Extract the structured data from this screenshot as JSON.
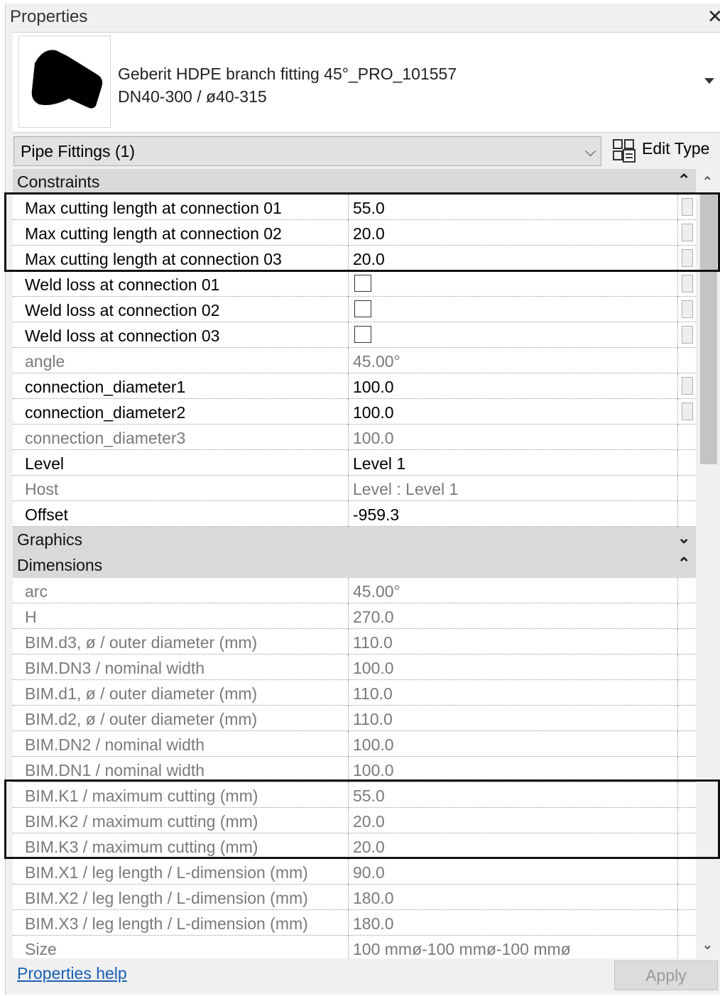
{
  "panel": {
    "title": "Properties",
    "close_glyph": "✕"
  },
  "type_selector": {
    "family_line1": "Geberit HDPE branch fitting 45°_PRO_101557",
    "family_line2": "DN40-300 / ø40-315",
    "thumbnail_icon": "pipe-branch-fitting-thumbnail"
  },
  "instance_selector": {
    "label": "Pipe Fittings (1)"
  },
  "edit_type": {
    "label": "Edit Type",
    "icon": "edit-type-icon"
  },
  "groups": {
    "constraints": {
      "label": "Constraints",
      "toggle": "⌃"
    },
    "graphics": {
      "label": "Graphics",
      "toggle": "⌄"
    },
    "dimensions": {
      "label": "Dimensions",
      "toggle": "⌃"
    }
  },
  "constraints_rows": [
    {
      "name": "Max cutting length at connection 01",
      "value": "55.0"
    },
    {
      "name": "Max cutting length at connection 02",
      "value": "20.0"
    },
    {
      "name": "Max cutting length at connection 03",
      "value": "20.0"
    },
    {
      "name": "Weld loss at connection 01",
      "value": "",
      "checkbox": false
    },
    {
      "name": "Weld loss at connection 02",
      "value": "",
      "checkbox": false
    },
    {
      "name": "Weld loss at connection 03",
      "value": "",
      "checkbox": false
    },
    {
      "name": "angle",
      "value": "45.00°"
    },
    {
      "name": "connection_diameter1",
      "value": "100.0"
    },
    {
      "name": "connection_diameter2",
      "value": "100.0"
    },
    {
      "name": "connection_diameter3",
      "value": "100.0"
    },
    {
      "name": "Level",
      "value": "Level 1"
    },
    {
      "name": "Host",
      "value": "Level : Level 1"
    },
    {
      "name": "Offset",
      "value": "-959.3"
    }
  ],
  "dimensions_rows": [
    {
      "name": "arc",
      "value": "45.00°"
    },
    {
      "name": "H",
      "value": "270.0"
    },
    {
      "name": "BIM.d3, ø / outer diameter (mm)",
      "value": "110.0"
    },
    {
      "name": "BIM.DN3 / nominal width",
      "value": "100.0"
    },
    {
      "name": "BIM.d1, ø / outer diameter (mm)",
      "value": "110.0"
    },
    {
      "name": "BIM.d2, ø / outer diameter (mm)",
      "value": "110.0"
    },
    {
      "name": "BIM.DN2 / nominal width",
      "value": "100.0"
    },
    {
      "name": "BIM.DN1 / nominal width",
      "value": "100.0"
    },
    {
      "name": "BIM.K1 / maximum cutting (mm)",
      "value": "55.0"
    },
    {
      "name": "BIM.K2 / maximum cutting (mm)",
      "value": "20.0"
    },
    {
      "name": "BIM.K3 / maximum cutting (mm)",
      "value": "20.0"
    },
    {
      "name": "BIM.X1 / leg length / L-dimension (mm)",
      "value": "90.0"
    },
    {
      "name": "BIM.X2 / leg length / L-dimension (mm)",
      "value": "180.0"
    },
    {
      "name": "BIM.X3 / leg length / L-dimension (mm)",
      "value": "180.0"
    },
    {
      "name": "Size",
      "value": "100 mmø-100 mmø-100 mmø"
    }
  ],
  "footer": {
    "help_link": "Properties help",
    "apply_label": "Apply"
  }
}
